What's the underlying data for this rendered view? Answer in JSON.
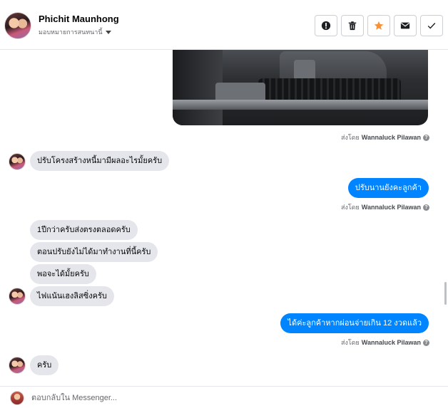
{
  "header": {
    "contact_name": "Phichit Maunhong",
    "assign_label": "มอบหมายการสนทนานี้",
    "actions": [
      {
        "name": "report-button",
        "icon": "alert-circle-icon"
      },
      {
        "name": "delete-button",
        "icon": "trash-icon"
      },
      {
        "name": "star-button",
        "icon": "star-icon",
        "color": "#f7923b"
      },
      {
        "name": "mark-unread-button",
        "icon": "envelope-icon"
      },
      {
        "name": "mark-done-button",
        "icon": "check-icon"
      }
    ]
  },
  "messages": [
    {
      "type": "image",
      "from": "page",
      "content": "photo of car interior floor mats"
    },
    {
      "type": "meta",
      "sent_by_label": "ส่งโดย",
      "sender": "Wannaluck Pilawan"
    },
    {
      "type": "text",
      "from": "customer",
      "text": "ปรับโครงสร้างหนี้มามีผลอะไรมั้ยครับ"
    },
    {
      "type": "text",
      "from": "page",
      "text": "ปรับนานยังคะลูกค้า"
    },
    {
      "type": "meta",
      "sent_by_label": "ส่งโดย",
      "sender": "Wannaluck Pilawan"
    },
    {
      "type": "text",
      "from": "customer",
      "text": "1ปีกว่าครับส่งตรงตลอดครับ"
    },
    {
      "type": "text",
      "from": "customer",
      "text": "ตอนปรับยังไม่ได้มาทำงานที่นี้ครับ"
    },
    {
      "type": "text",
      "from": "customer",
      "text": "พอจะได้มั้ยครับ"
    },
    {
      "type": "text",
      "from": "customer",
      "text": "ไฟแน้นเฮงลิสซิ่งครับ"
    },
    {
      "type": "text",
      "from": "page",
      "text": "ได้ค่ะลูกค้าหากผ่อนจ่ายเกิน 12 งวดแล้ว"
    },
    {
      "type": "meta",
      "sent_by_label": "ส่งโดย",
      "sender": "Wannaluck Pilawan"
    },
    {
      "type": "text",
      "from": "customer",
      "text": "ครับ"
    }
  ],
  "composer": {
    "placeholder": "ตอบกลับใน Messenger..."
  },
  "colors": {
    "outgoing_bubble": "#0084ff",
    "incoming_bubble": "#e4e6eb",
    "star_accent": "#f7923b"
  }
}
